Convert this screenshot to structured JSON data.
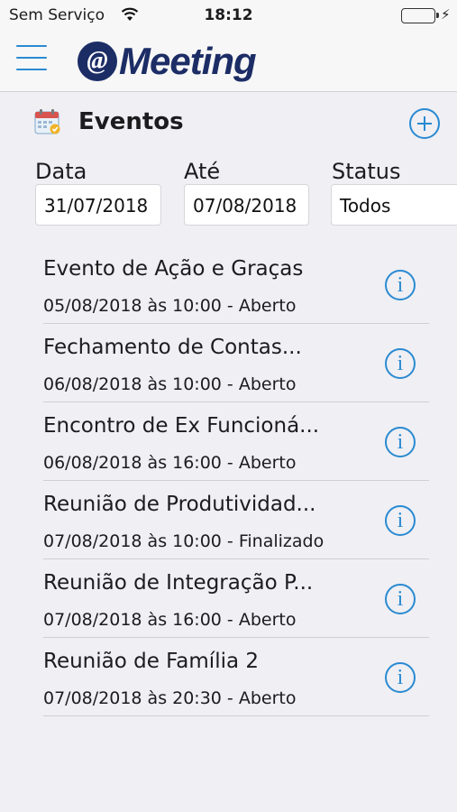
{
  "status_bar": {
    "carrier": "Sem Serviço",
    "time": "18:12"
  },
  "header": {
    "logo_at": "@",
    "logo_text": "Meeting"
  },
  "section": {
    "title": "Eventos"
  },
  "filters": {
    "data_label": "Data",
    "data_value": "31/07/2018",
    "ate_label": "Até",
    "ate_value": "07/08/2018",
    "status_label": "Status",
    "status_value": "Todos"
  },
  "events": [
    {
      "title": "Evento de Ação e Graças",
      "subtitle": "05/08/2018 às 10:00 - Aberto"
    },
    {
      "title": "Fechamento de Contas...",
      "subtitle": "06/08/2018 às 10:00 - Aberto"
    },
    {
      "title": "Encontro de Ex Funcioná...",
      "subtitle": "06/08/2018 às 16:00 - Aberto"
    },
    {
      "title": "Reunião de Produtividad...",
      "subtitle": "07/08/2018 às 10:00 - Finalizado"
    },
    {
      "title": "Reunião de Integração P...",
      "subtitle": "07/08/2018 às 16:00 - Aberto"
    },
    {
      "title": "Reunião de Família 2",
      "subtitle": "07/08/2018 às 20:30 - Aberto"
    }
  ],
  "icons": {
    "info": "i",
    "wifi": "wifi-icon",
    "battery": "battery-icon",
    "menu": "hamburger-menu-icon",
    "add": "plus-circle-icon",
    "calendar": "calendar-icon"
  },
  "colors": {
    "accent": "#2a8ad1",
    "brand": "#1c2d66",
    "battery": "#4cd964"
  }
}
